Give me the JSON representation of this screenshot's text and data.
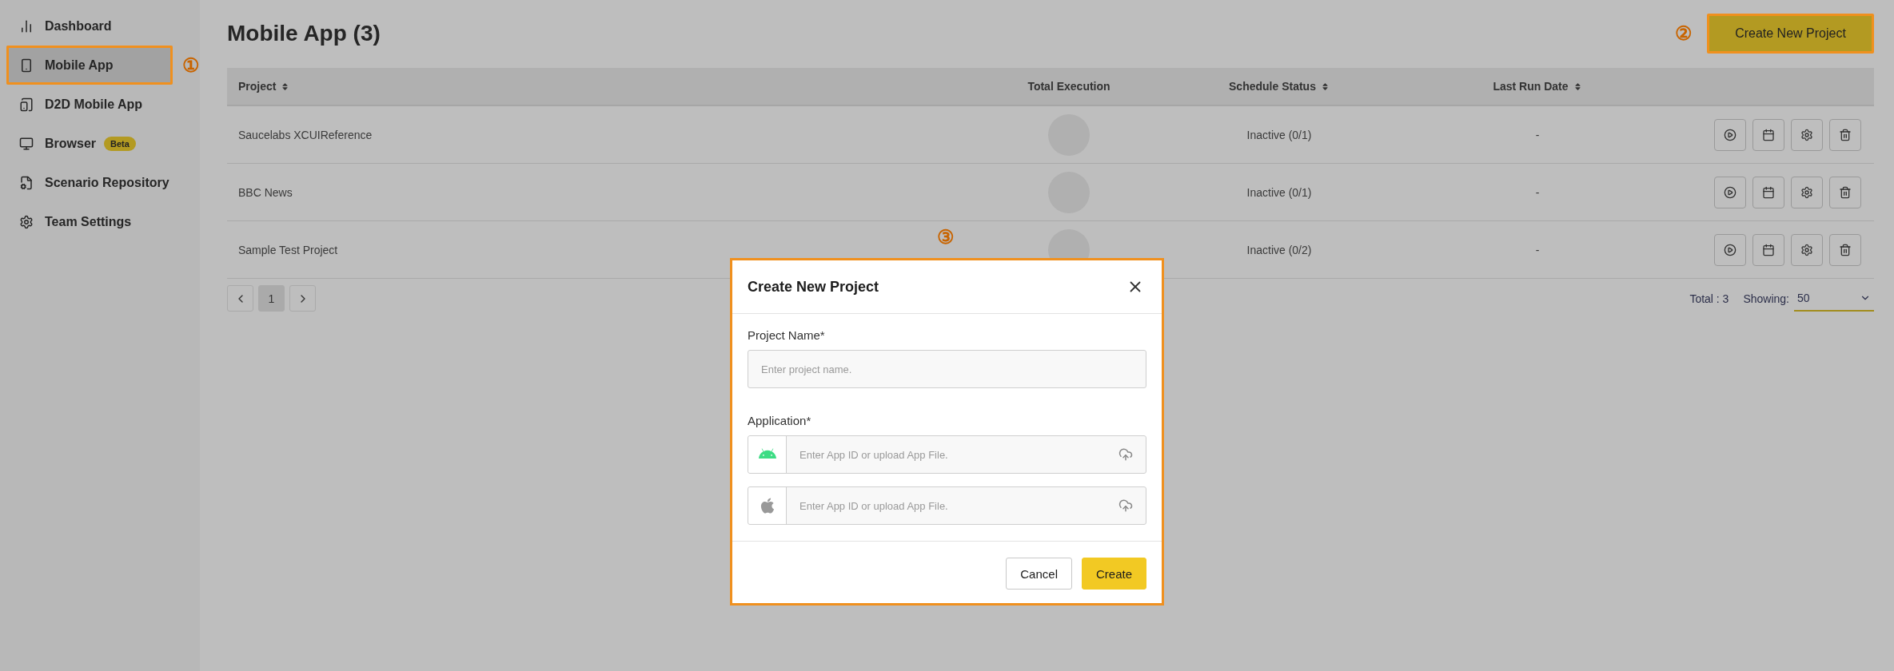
{
  "sidebar": {
    "items": [
      {
        "label": "Dashboard",
        "selected": false
      },
      {
        "label": "Mobile App",
        "selected": true,
        "callout": "①"
      },
      {
        "label": "D2D Mobile App",
        "selected": false
      },
      {
        "label": "Browser",
        "selected": false,
        "badge": "Beta"
      },
      {
        "label": "Scenario Repository",
        "selected": false
      },
      {
        "label": "Team Settings",
        "selected": false
      }
    ]
  },
  "header": {
    "title": "Mobile App (3)",
    "button": {
      "label": "Create New Project",
      "callout": "②"
    }
  },
  "table": {
    "columns": [
      {
        "label": "Project",
        "sortable": true
      },
      {
        "label": "Total Execution",
        "sortable": false
      },
      {
        "label": "Schedule Status",
        "sortable": true
      },
      {
        "label": "Last Run Date",
        "sortable": true
      }
    ],
    "rows": [
      {
        "project": "Saucelabs XCUIReference",
        "schedule_status": "Inactive (0/1)",
        "last_run_date": "-"
      },
      {
        "project": "BBC News",
        "schedule_status": "Inactive (0/1)",
        "last_run_date": "-"
      },
      {
        "project": "Sample Test Project",
        "schedule_status": "Inactive (0/2)",
        "last_run_date": "-"
      }
    ]
  },
  "pagination": {
    "pages": [
      {
        "label": "1",
        "selected": true
      }
    ],
    "total": "Total : 3",
    "showing_label": "Showing:",
    "showing_value": "50"
  },
  "dialog": {
    "title": "Create New Project",
    "callout": "③",
    "project_name": {
      "label": "Project Name*",
      "placeholder": "Enter project name."
    },
    "application": {
      "label": "Application*",
      "fields": [
        {
          "kind": "android",
          "placeholder": "Enter App ID or upload App File."
        },
        {
          "kind": "ios",
          "placeholder": "Enter App ID or upload App File."
        }
      ]
    },
    "buttons": [
      {
        "label": "Cancel",
        "kind": "secondary"
      },
      {
        "label": "Create",
        "kind": "primary"
      }
    ]
  }
}
